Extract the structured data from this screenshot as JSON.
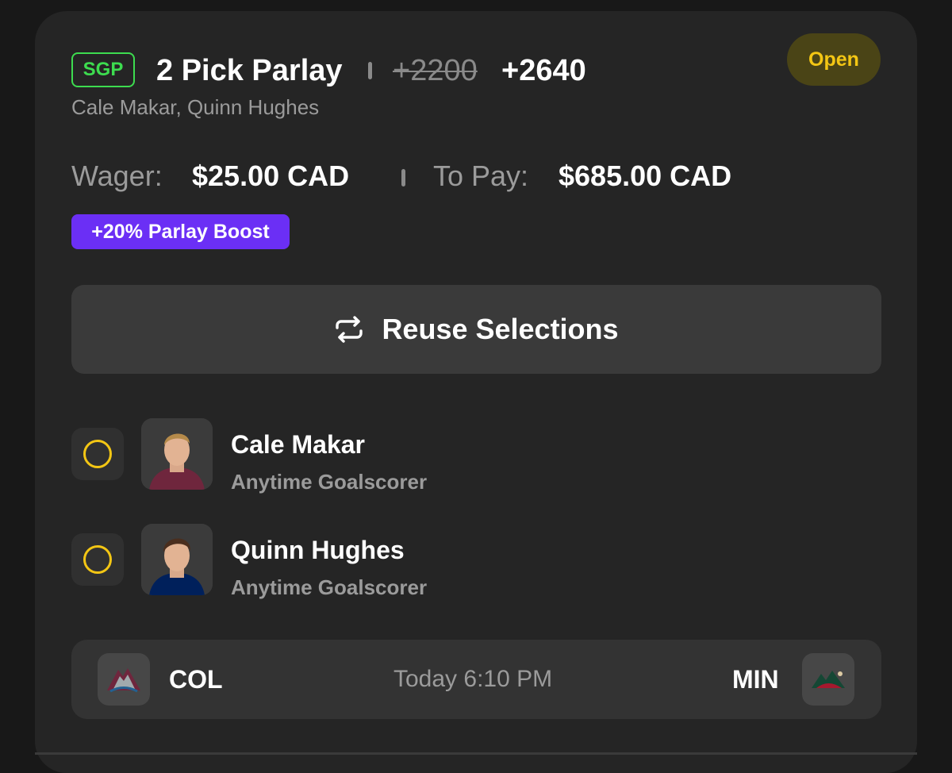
{
  "bet": {
    "type_badge": "SGP",
    "title": "2 Pick Parlay",
    "original_odds": "+2200",
    "boosted_odds": "+2640",
    "players_summary": "Cale Makar, Quinn Hughes",
    "status": "Open",
    "wager_label": "Wager:",
    "wager_value": "$25.00 CAD",
    "to_pay_label": "To Pay:",
    "to_pay_value": "$685.00 CAD",
    "boost_label": "+20% Parlay Boost"
  },
  "reuse_button": {
    "label": "Reuse Selections",
    "icon": "repeat-icon"
  },
  "legs": [
    {
      "player": "Cale Makar",
      "market": "Anytime Goalscorer",
      "jersey_color": "#6f263d"
    },
    {
      "player": "Quinn Hughes",
      "market": "Anytime Goalscorer",
      "jersey_color": "#00205b"
    }
  ],
  "game": {
    "home_team": "COL",
    "away_team": "MIN",
    "time": "Today 6:10 PM"
  },
  "colors": {
    "sgp_green": "#3ddc4f",
    "open_yellow": "#f3c614",
    "boost_purple": "#6b2ff5"
  }
}
